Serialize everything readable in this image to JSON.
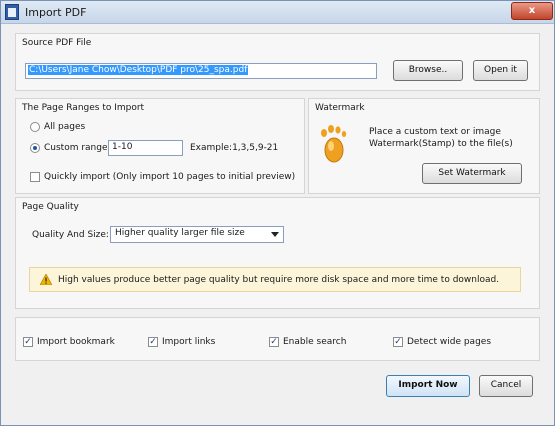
{
  "window": {
    "title": "Import PDF",
    "close_glyph": "x"
  },
  "source": {
    "group_title": "Source PDF File",
    "path_value": "C:\\Users\\Jane Chow\\Desktop\\PDF pro\\25_spa.pdf",
    "browse_label": "Browse..",
    "open_label": "Open it"
  },
  "ranges": {
    "group_title": "The Page Ranges to Import",
    "all_pages_label": "All pages",
    "custom_range_label": "Custom range:",
    "custom_range_value": "1-10",
    "example_text": "Example:1,3,5,9-21",
    "quick_import_label": "Quickly import (Only import 10 pages to  initial  preview)",
    "selected_option": "custom_range",
    "quick_import_checked": false
  },
  "watermark": {
    "group_title": "Watermark",
    "description_line1": "Place a custom text or image",
    "description_line2": "Watermark(Stamp) to the file(s)",
    "set_button_label": "Set Watermark",
    "icon": "footprint-icon"
  },
  "quality": {
    "group_title": "Page Quality",
    "label": "Quality And Size:",
    "selected_value": "Higher quality larger file size",
    "warning_text": "High values produce better page quality but require more disk space and more time to download."
  },
  "options": [
    {
      "label": "Import bookmark",
      "checked": true
    },
    {
      "label": "Import links",
      "checked": true
    },
    {
      "label": "Enable search",
      "checked": true
    },
    {
      "label": "Detect wide pages",
      "checked": true
    }
  ],
  "footer": {
    "import_label": "Import Now",
    "cancel_label": "Cancel"
  },
  "colors": {
    "accent": "#3399ff",
    "footprint": "#f0a020",
    "warning_bg": "#fdf5d9"
  }
}
